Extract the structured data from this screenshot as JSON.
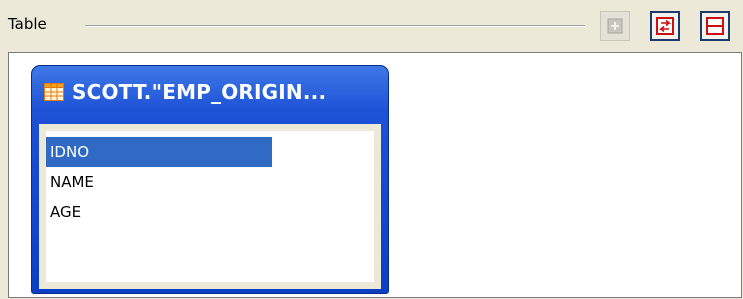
{
  "toolbar": {
    "section_label": "Table",
    "buttons": [
      {
        "icon": "table-plus-icon",
        "state": "disabled"
      },
      {
        "icon": "swap-arrows-icon",
        "state": "enabled",
        "accent": "#cc1010"
      },
      {
        "icon": "table-row-icon",
        "state": "enabled",
        "accent": "#cc1010"
      }
    ]
  },
  "table_card": {
    "title": "SCOTT.\"EMP_ORIGIN...",
    "icon": "table-grid-icon",
    "columns": [
      {
        "label": "IDNO",
        "selected": true
      },
      {
        "label": "NAME",
        "selected": false
      },
      {
        "label": "AGE",
        "selected": false
      }
    ]
  },
  "colors": {
    "card_blue": "#0b3fc4",
    "selection": "#316ac5",
    "panel_bg": "#ece9d8"
  }
}
